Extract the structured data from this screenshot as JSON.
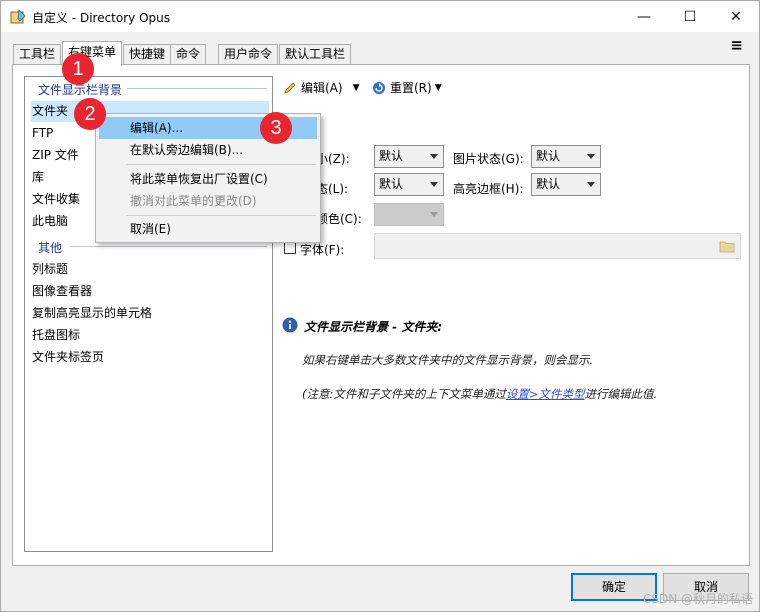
{
  "window": {
    "title": "自定义 - Directory Opus",
    "controls": {
      "minimize": "—",
      "maximize": "☐",
      "close": "✕"
    },
    "menu_icon": "≡"
  },
  "tabs": [
    {
      "label": "工具栏"
    },
    {
      "label": "右键菜单",
      "active": true
    },
    {
      "label": "快捷键"
    },
    {
      "label": "命令"
    },
    {
      "label": "用户命令"
    },
    {
      "label": "默认工具栏"
    }
  ],
  "left_list": {
    "group1": "文件显示栏背景",
    "group1_items": [
      "文件夹",
      "FTP",
      "ZIP 文件",
      "库",
      "文件收集",
      "此电脑"
    ],
    "group2": "其他",
    "group2_items": [
      "列标题",
      "图像查看器",
      "复制高亮显示的单元格",
      "托盘图标",
      "文件夹标签页"
    ]
  },
  "right_panel": {
    "edit_button": "编辑(A)",
    "reset_button": "重置(R)",
    "size_label": "小(Z):",
    "size_value": "默认",
    "image_state_label": "图片状态(G):",
    "image_state_value": "默认",
    "state_label": "态(L):",
    "state_value": "默认",
    "highlight_border_label": "高亮边框(H):",
    "highlight_border_value": "默认",
    "color_label": "颜色(C):",
    "font_label": "字体(F):",
    "info_title": "文件显示栏背景 - 文件夹:",
    "info_text1": "如果右键单击大多数文件夹中的文件显示背景，则会显示.",
    "info_text2_prefix": "(注意:文件和子文件夹的上下文菜单通过",
    "info_link": "设置>文件类型",
    "info_text2_suffix": "进行编辑此值."
  },
  "context_menu": {
    "items": [
      {
        "label": "编辑(A)...",
        "highlighted": true
      },
      {
        "label": "在默认旁边编辑(B)..."
      },
      {
        "label": "将此菜单恢复出厂设置(C)"
      },
      {
        "label": "撤消对此菜单的更改(D)",
        "disabled": true
      },
      {
        "label": "取消(E)"
      }
    ]
  },
  "buttons": {
    "ok": "确定",
    "cancel": "取消"
  },
  "badges": [
    "1",
    "2",
    "3"
  ],
  "watermark": "CSDN @秋月的私语",
  "colors": {
    "accent": "#0078d7",
    "selection": "#cce8ff",
    "menu_hover": "#91c9f7",
    "badge": "#e8262f"
  }
}
